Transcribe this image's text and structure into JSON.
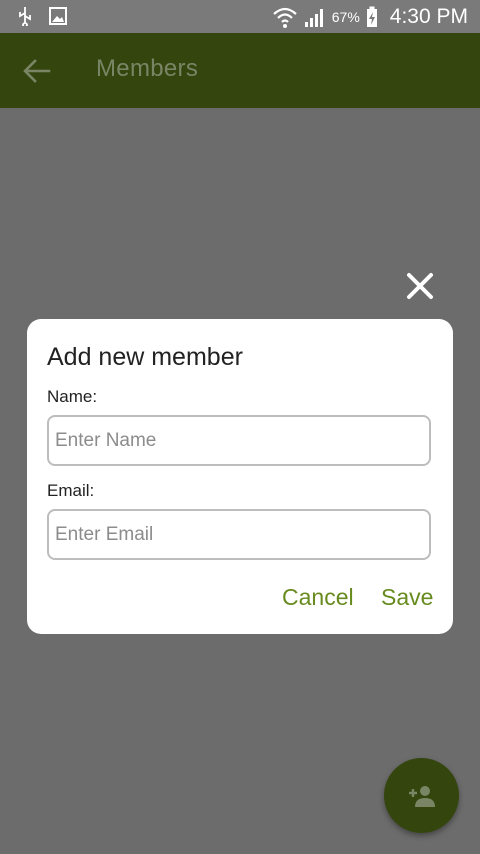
{
  "status_bar": {
    "battery_percent": "67%",
    "time": "4:30 PM",
    "icons": [
      "usb-icon",
      "image-icon",
      "wifi-icon",
      "signal-icon",
      "battery-charging-icon"
    ]
  },
  "app_bar": {
    "title": "Members",
    "back_icon": "arrow-back-icon",
    "color": "#34450d"
  },
  "dialog": {
    "title": "Add new member",
    "name_label": "Name:",
    "name_placeholder": "Enter Name",
    "email_label": "Email:",
    "email_placeholder": "Enter Email",
    "cancel_label": "Cancel",
    "save_label": "Save",
    "accent_color": "#678b1e"
  },
  "overlay": {
    "close_icon": "close-icon"
  },
  "fab": {
    "icon": "person-add-icon"
  }
}
